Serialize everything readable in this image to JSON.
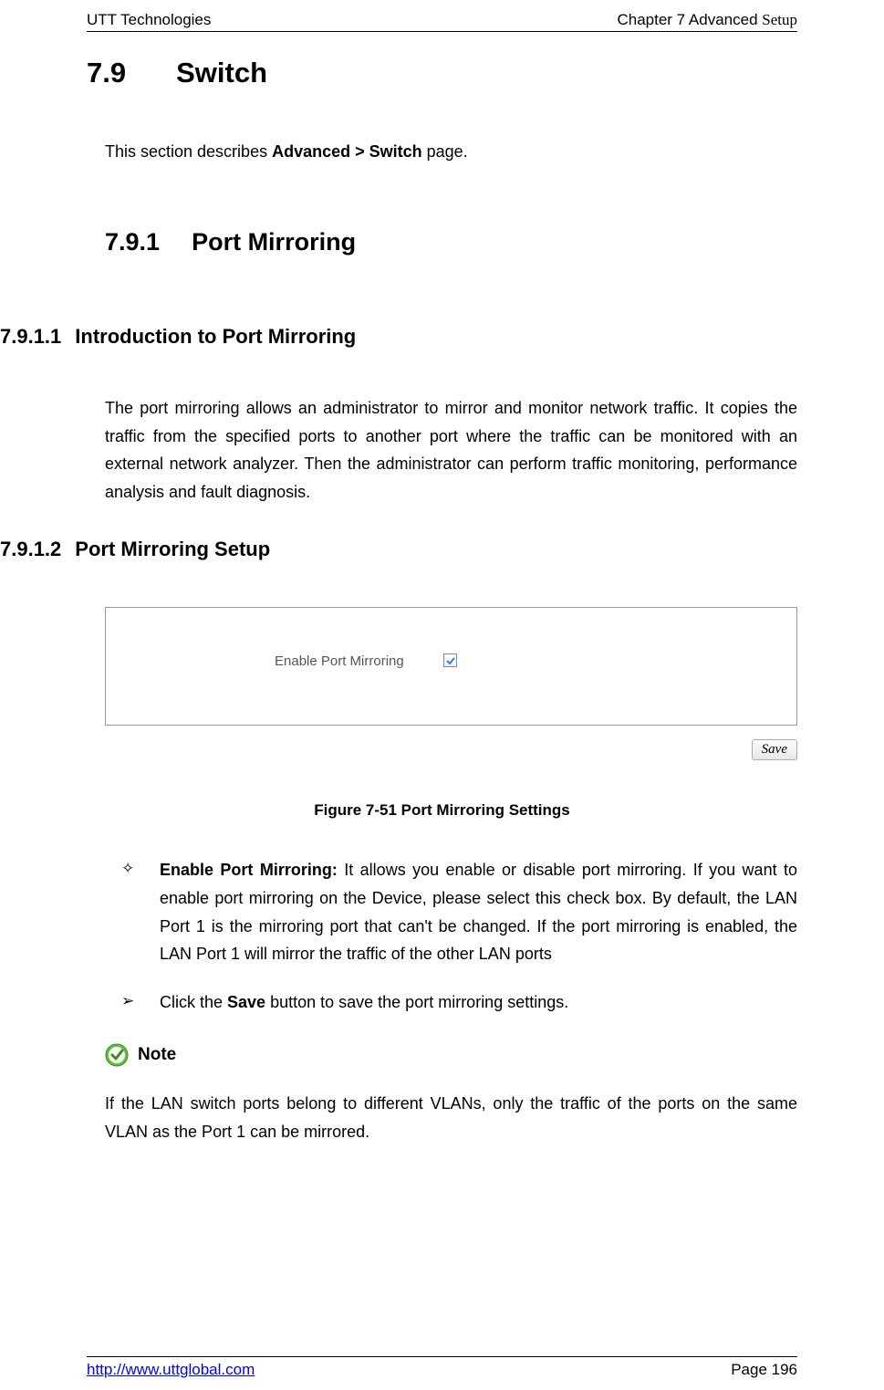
{
  "header": {
    "left": "UTT Technologies",
    "right_prefix": "Chapter 7 Advanced ",
    "right_suffix": "Setup"
  },
  "sections": {
    "h1_num": "7.9",
    "h1_title": "Switch",
    "intro_prefix": "This section describes ",
    "intro_bold": "Advanced > Switch",
    "intro_suffix": " page.",
    "h2_num": "7.9.1",
    "h2_title": "Port Mirroring",
    "h3a_num": "7.9.1.1",
    "h3a_title": "Introduction to Port Mirroring",
    "intro_body": "The port mirroring allows an administrator to mirror and monitor network traffic. It copies the traffic from the specified ports to another port where the traffic can be monitored with an external network analyzer. Then the administrator can perform traffic monitoring, performance analysis and fault diagnosis.",
    "h3b_num": "7.9.1.2",
    "h3b_title": "Port Mirroring Setup"
  },
  "figure": {
    "checkbox_label": "Enable Port Mirroring",
    "save_button": "Save",
    "caption": "Figure 7-51 Port Mirroring Settings"
  },
  "bullets": {
    "b1_marker": "✧",
    "b1_bold": "Enable Port Mirroring:",
    "b1_text": " It allows you enable or disable port mirroring. If you want to enable port mirroring on the Device, please select this check box. By default, the LAN Port 1 is the mirroring port that can't be changed. If the port mirroring is enabled, the LAN Port 1 will mirror the traffic of the other LAN ports",
    "b2_marker": "➢",
    "b2_prefix": "Click the ",
    "b2_bold": "Save",
    "b2_suffix": " button to save the port mirroring settings."
  },
  "note": {
    "label": "Note",
    "text": "If the LAN switch ports belong to different VLANs, only the traffic of the ports on the same VLAN as the Port 1 can be mirrored."
  },
  "footer": {
    "left": "http://www.uttglobal.com",
    "right": "Page 196"
  }
}
